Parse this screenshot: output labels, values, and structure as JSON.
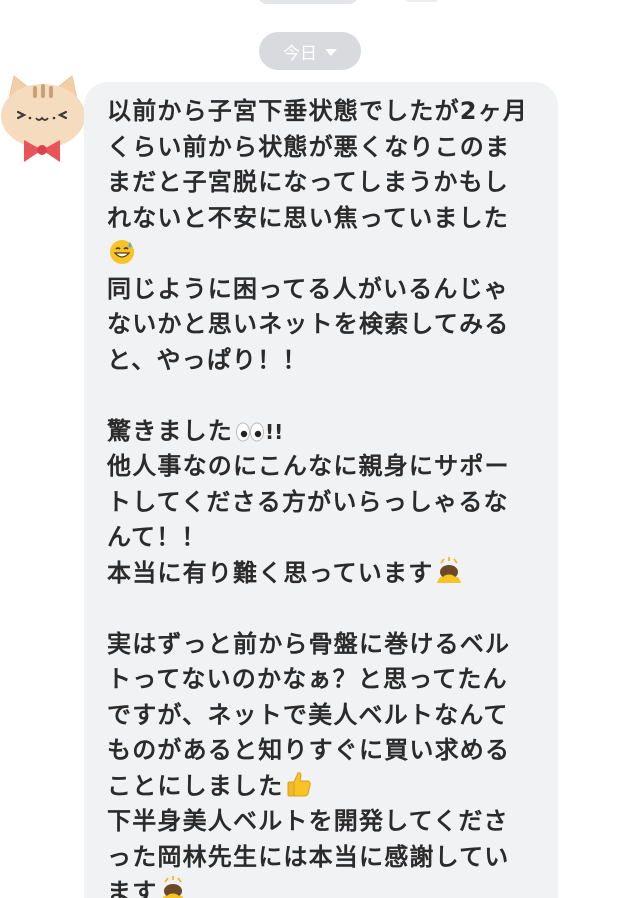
{
  "header": {
    "date_label": "今日"
  },
  "message": {
    "lines": [
      "以前から子宮下垂状態でしたが2ヶ月",
      "くらい前から状態が悪くなりこのま",
      "まだと子宮脱になってしまうかもし",
      "れないと不安に思い焦っていました",
      "",
      "同じように困ってる人がいるんじゃ",
      "ないかと思いネットを検索してみる",
      "と、やっぱり！！",
      "",
      "驚きました",
      "他人事なのにこんなに親身にサポー",
      "トしてくださる方がいらっしゃるな",
      "んて！！",
      "本当に有り難く思っています",
      "",
      "実はずっと前から骨盤に巻けるベル",
      "トってないのかなぁ？と思ってたん",
      "ですが、ネットで美人ベルトなんて",
      "ものがあると知りすぐに買い求める",
      "ことにしました",
      "下半身美人ベルトを開発してくださ",
      "った岡林先生には本当に感謝してい",
      "ます"
    ],
    "suffix_exclaim": "!!"
  },
  "icons": {
    "avatar": "cat-avatar-icon",
    "sweat_smile": "sweat-smile-emoji-icon",
    "eyes": "eyes-emoji-icon",
    "bowing": "bowing-emoji-icon",
    "thumbs_up": "thumbs-up-emoji-icon",
    "caret": "chevron-down-icon"
  },
  "colors": {
    "bubble": "#f1f2f4",
    "text": "#2b2b2b",
    "chip": "#d9dadd"
  }
}
